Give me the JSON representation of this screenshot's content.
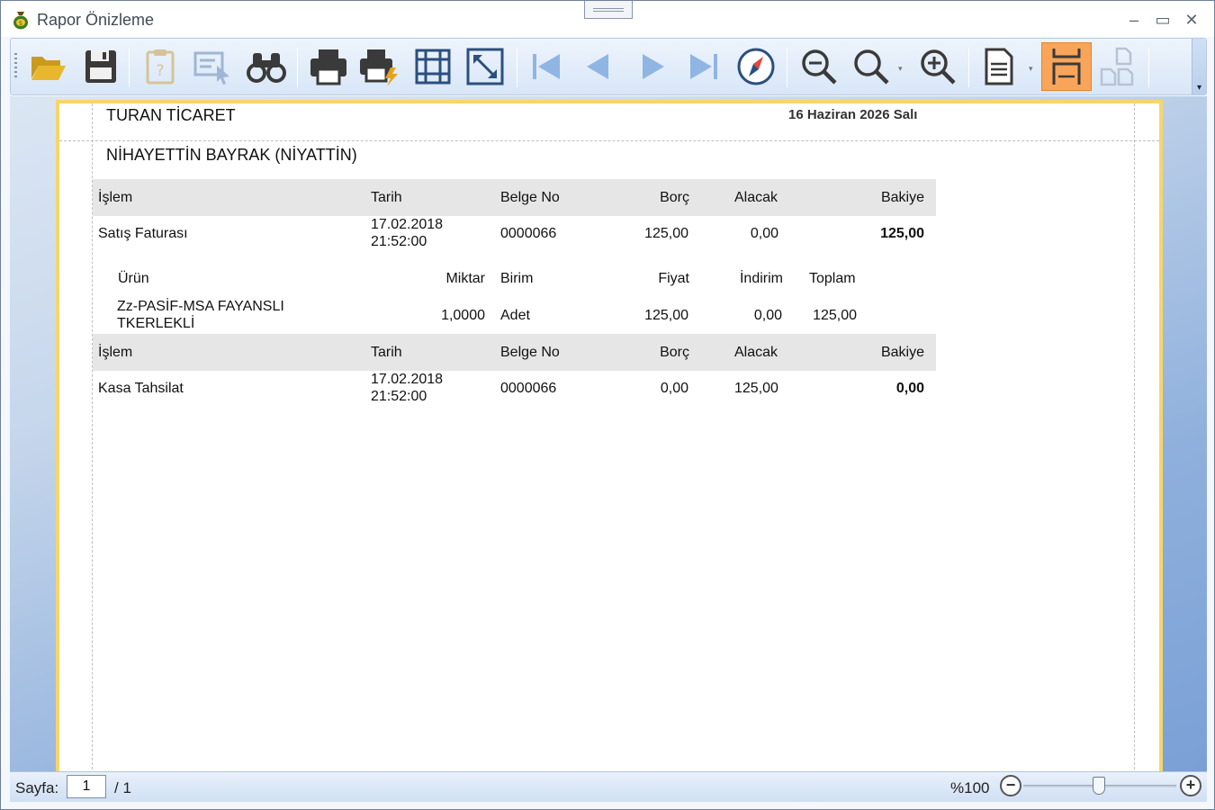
{
  "window": {
    "title": "Rapor Önizleme",
    "minimize": "–",
    "maximize": "▭",
    "close": "✕"
  },
  "toolbar": {
    "buttons": [
      {
        "name": "open-icon",
        "enabled": true
      },
      {
        "name": "save-icon",
        "enabled": true
      },
      {
        "name": "parameters-icon",
        "enabled": false
      },
      {
        "name": "select-icon",
        "enabled": false
      },
      {
        "name": "find-icon",
        "enabled": true
      },
      {
        "name": "print-icon",
        "enabled": true
      },
      {
        "name": "quick-print-icon",
        "enabled": true
      },
      {
        "name": "margins-icon",
        "enabled": true
      },
      {
        "name": "fit-page-icon",
        "enabled": true
      },
      {
        "name": "first-page-icon",
        "enabled": false
      },
      {
        "name": "previous-page-icon",
        "enabled": false
      },
      {
        "name": "next-page-icon",
        "enabled": false
      },
      {
        "name": "last-page-icon",
        "enabled": false
      },
      {
        "name": "navigation-icon",
        "enabled": true
      },
      {
        "name": "zoom-out-icon",
        "enabled": true
      },
      {
        "name": "zoom-icon",
        "enabled": true
      },
      {
        "name": "zoom-in-icon",
        "enabled": true
      },
      {
        "name": "page-setup-icon",
        "enabled": true
      },
      {
        "name": "single-page-icon",
        "enabled": true,
        "active": true
      },
      {
        "name": "multi-page-icon",
        "enabled": false
      }
    ],
    "overflow": "▾",
    "dropdown_arrow": "▾"
  },
  "report": {
    "company": "TURAN TİCARET",
    "date": "16 Haziran 2026 Salı",
    "customer": "NİHAYETTİN BAYRAK (NİYATTİN)",
    "transaction_headers": [
      "İşlem",
      "Tarih",
      "Belge No",
      "Borç",
      "Alacak",
      "Bakiye"
    ],
    "product_headers": [
      "Ürün",
      "Miktar",
      "Birim",
      "Fiyat",
      "İndirim",
      "Toplam"
    ],
    "transactions": [
      {
        "islem": "Satış Faturası",
        "tarih_date": "17.02.2018",
        "tarih_time": "21:52:00",
        "belge_no": "0000066",
        "borc": "125,00",
        "alacak": "0,00",
        "bakiye": "125,00",
        "products": [
          {
            "urun_line1": "Zz-PASİF-MSA FAYANSLI",
            "urun_line2": "TKERLEKLİ",
            "miktar": "1,0000",
            "birim": "Adet",
            "fiyat": "125,00",
            "indirim": "0,00",
            "toplam": "125,00"
          }
        ]
      },
      {
        "islem": "Kasa Tahsilat",
        "tarih_date": "17.02.2018",
        "tarih_time": "21:52:00",
        "belge_no": "0000066",
        "borc": "0,00",
        "alacak": "125,00",
        "bakiye": "0,00"
      }
    ]
  },
  "statusbar": {
    "page_label": "Sayfa:",
    "page_value": "1",
    "page_total": "/ 1",
    "zoom_label": "%100",
    "zoom_minus": "−",
    "zoom_plus": "+"
  }
}
